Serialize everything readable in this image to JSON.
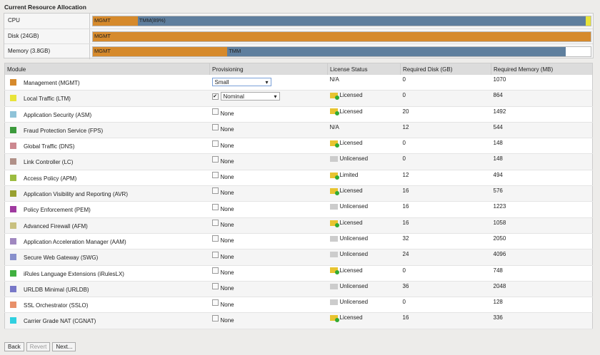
{
  "title": "Current Resource Allocation",
  "allocation": [
    {
      "label": "CPU",
      "segments": [
        {
          "label": "MGMT",
          "type": "mg",
          "percent": 9
        },
        {
          "label": "TMM(89%)",
          "type": "tm",
          "percent": 90
        },
        {
          "label": "",
          "type": "ye",
          "percent": 1
        }
      ]
    },
    {
      "label": "Disk (24GB)",
      "segments": [
        {
          "label": "MGMT",
          "type": "mg",
          "percent": 100
        }
      ]
    },
    {
      "label": "Memory (3.8GB)",
      "segments": [
        {
          "label": "MGMT",
          "type": "mg",
          "percent": 27
        },
        {
          "label": "TMM",
          "type": "tm",
          "percent": 68
        }
      ]
    }
  ],
  "headers": [
    "Module",
    "Provisioning",
    "License Status",
    "Required Disk (GB)",
    "Required Memory (MB)"
  ],
  "modules": [
    {
      "name": "Management (MGMT)",
      "color": "#d68a2c",
      "prov": "select",
      "value": "Small",
      "license": "N/A",
      "lic": "",
      "disk": "0",
      "mem": "1070"
    },
    {
      "name": "Local Traffic (LTM)",
      "color": "#e8e43a",
      "prov": "checked-select",
      "value": "Nominal",
      "license": "Licensed",
      "lic": "ok",
      "disk": "0",
      "mem": "864"
    },
    {
      "name": "Application Security (ASM)",
      "color": "#8fc3d8",
      "prov": "none",
      "value": "None",
      "license": "Licensed",
      "lic": "ok",
      "disk": "20",
      "mem": "1492"
    },
    {
      "name": "Fraud Protection Service (FPS)",
      "color": "#3c9a3c",
      "prov": "none",
      "value": "None",
      "license": "N/A",
      "lic": "",
      "disk": "12",
      "mem": "544"
    },
    {
      "name": "Global Traffic (DNS)",
      "color": "#cc8890",
      "prov": "none",
      "value": "None",
      "license": "Licensed",
      "lic": "ok",
      "disk": "0",
      "mem": "148"
    },
    {
      "name": "Link Controller (LC)",
      "color": "#b09088",
      "prov": "none",
      "value": "None",
      "license": "Unlicensed",
      "lic": "no",
      "disk": "0",
      "mem": "148"
    },
    {
      "name": "Access Policy (APM)",
      "color": "#9cbc40",
      "prov": "none",
      "value": "None",
      "license": "Limited",
      "lic": "ok",
      "disk": "12",
      "mem": "494"
    },
    {
      "name": "Application Visibility and Reporting (AVR)",
      "color": "#98a030",
      "prov": "none",
      "value": "None",
      "license": "Licensed",
      "lic": "ok",
      "disk": "16",
      "mem": "576"
    },
    {
      "name": "Policy Enforcement (PEM)",
      "color": "#a03aa0",
      "prov": "none",
      "value": "None",
      "license": "Unlicensed",
      "lic": "no",
      "disk": "16",
      "mem": "1223"
    },
    {
      "name": "Advanced Firewall (AFM)",
      "color": "#c8c080",
      "prov": "none",
      "value": "None",
      "license": "Licensed",
      "lic": "ok",
      "disk": "16",
      "mem": "1058"
    },
    {
      "name": "Application Acceleration Manager (AAM)",
      "color": "#a088c0",
      "prov": "none",
      "value": "None",
      "license": "Unlicensed",
      "lic": "no",
      "disk": "32",
      "mem": "2050"
    },
    {
      "name": "Secure Web Gateway (SWG)",
      "color": "#8890cc",
      "prov": "none",
      "value": "None",
      "license": "Unlicensed",
      "lic": "no",
      "disk": "24",
      "mem": "4096"
    },
    {
      "name": "iRules Language Extensions (iRulesLX)",
      "color": "#40b040",
      "prov": "none",
      "value": "None",
      "license": "Licensed",
      "lic": "ok",
      "disk": "0",
      "mem": "748"
    },
    {
      "name": "URLDB Minimal (URLDB)",
      "color": "#7878c8",
      "prov": "none",
      "value": "None",
      "license": "Unlicensed",
      "lic": "no",
      "disk": "36",
      "mem": "2048"
    },
    {
      "name": "SSL Orchestrator (SSLO)",
      "color": "#e8906a",
      "prov": "none",
      "value": "None",
      "license": "Unlicensed",
      "lic": "no",
      "disk": "0",
      "mem": "128"
    },
    {
      "name": "Carrier Grade NAT (CGNAT)",
      "color": "#30d0e0",
      "prov": "none",
      "value": "None",
      "license": "Licensed",
      "lic": "ok",
      "disk": "16",
      "mem": "336"
    }
  ],
  "buttons": {
    "back": "Back",
    "revert": "Revert",
    "next": "Next..."
  }
}
